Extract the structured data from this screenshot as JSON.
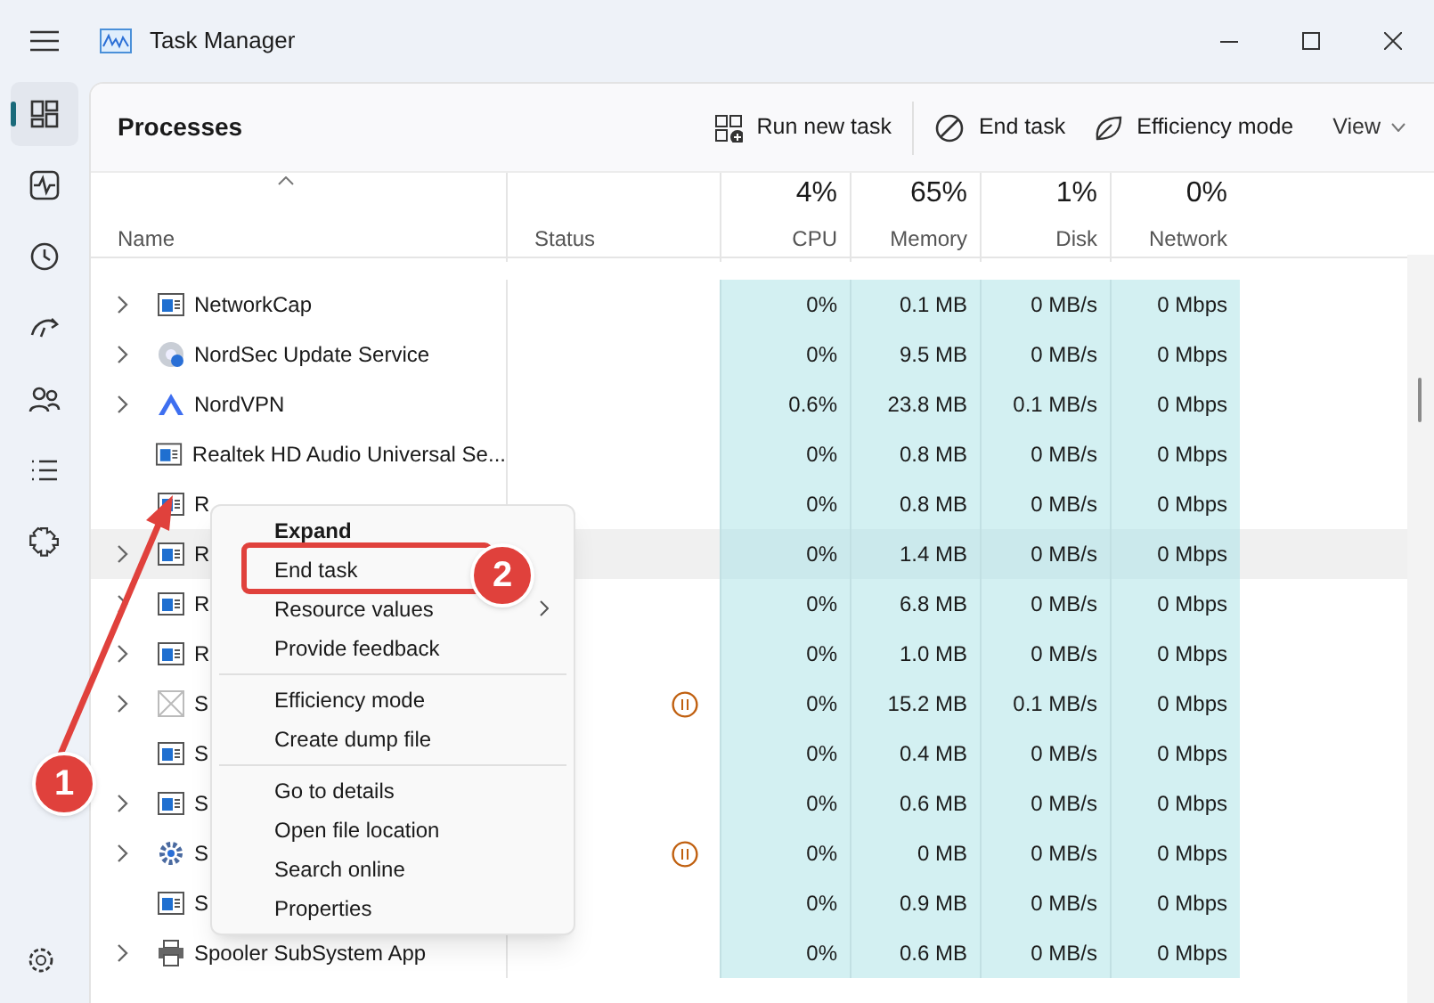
{
  "window": {
    "title": "Task Manager"
  },
  "nav": {
    "items": [
      {
        "kind": "processes",
        "selected": true
      },
      {
        "kind": "performance",
        "selected": false
      },
      {
        "kind": "history",
        "selected": false
      },
      {
        "kind": "startup",
        "selected": false
      },
      {
        "kind": "users",
        "selected": false
      },
      {
        "kind": "details",
        "selected": false
      },
      {
        "kind": "services",
        "selected": false
      }
    ]
  },
  "toolbar": {
    "title": "Processes",
    "actions": [
      {
        "kind": "run",
        "label": "Run new task"
      },
      {
        "kind": "end",
        "label": "End task"
      },
      {
        "kind": "efficiency",
        "label": "Efficiency mode"
      }
    ],
    "view": "View"
  },
  "columns": [
    {
      "label": "Name",
      "sorted": true
    },
    {
      "label": "Status",
      "sorted": false
    },
    {
      "total": "4%",
      "label": "CPU",
      "sorted": false
    },
    {
      "total": "65%",
      "label": "Memory",
      "sorted": false
    },
    {
      "total": "1%",
      "label": "Disk",
      "sorted": false
    },
    {
      "total": "0%",
      "label": "Network",
      "sorted": false
    }
  ],
  "rows": [
    {
      "name": "NetworkCap",
      "kind": "app",
      "expandable": true,
      "paused": false,
      "selected": false,
      "cpu": "0%",
      "memory": "0.1 MB",
      "disk": "0 MB/s",
      "network": "0 Mbps"
    },
    {
      "name": "NordSec Update Service",
      "kind": "disc",
      "expandable": true,
      "paused": false,
      "selected": false,
      "cpu": "0%",
      "memory": "9.5 MB",
      "disk": "0 MB/s",
      "network": "0 Mbps"
    },
    {
      "name": "NordVPN",
      "kind": "mountain",
      "expandable": true,
      "paused": false,
      "selected": false,
      "cpu": "0.6%",
      "memory": "23.8 MB",
      "disk": "0.1 MB/s",
      "network": "0 Mbps"
    },
    {
      "name": "Realtek HD Audio Universal Se...",
      "kind": "app",
      "expandable": false,
      "paused": false,
      "selected": false,
      "cpu": "0%",
      "memory": "0.8 MB",
      "disk": "0 MB/s",
      "network": "0 Mbps"
    },
    {
      "name": "R",
      "kind": "app",
      "expandable": false,
      "paused": false,
      "selected": false,
      "cpu": "0%",
      "memory": "0.8 MB",
      "disk": "0 MB/s",
      "network": "0 Mbps"
    },
    {
      "name": "R",
      "kind": "app",
      "expandable": true,
      "paused": false,
      "selected": true,
      "cpu": "0%",
      "memory": "1.4 MB",
      "disk": "0 MB/s",
      "network": "0 Mbps"
    },
    {
      "name": "R",
      "kind": "app",
      "expandable": true,
      "paused": false,
      "selected": false,
      "cpu": "0%",
      "memory": "6.8 MB",
      "disk": "0 MB/s",
      "network": "0 Mbps"
    },
    {
      "name": "R",
      "kind": "app",
      "expandable": true,
      "paused": false,
      "selected": false,
      "cpu": "0%",
      "memory": "1.0 MB",
      "disk": "0 MB/s",
      "network": "0 Mbps"
    },
    {
      "name": "S",
      "kind": "blank",
      "expandable": true,
      "paused": true,
      "selected": false,
      "cpu": "0%",
      "memory": "15.2 MB",
      "disk": "0.1 MB/s",
      "network": "0 Mbps"
    },
    {
      "name": "S",
      "kind": "app",
      "expandable": false,
      "paused": false,
      "selected": false,
      "cpu": "0%",
      "memory": "0.4 MB",
      "disk": "0 MB/s",
      "network": "0 Mbps"
    },
    {
      "name": "S",
      "kind": "app",
      "expandable": true,
      "paused": false,
      "selected": false,
      "cpu": "0%",
      "memory": "0.6 MB",
      "disk": "0 MB/s",
      "network": "0 Mbps"
    },
    {
      "name": "S",
      "kind": "gear",
      "expandable": true,
      "paused": true,
      "selected": false,
      "cpu": "0%",
      "memory": "0 MB",
      "disk": "0 MB/s",
      "network": "0 Mbps"
    },
    {
      "name": "S",
      "kind": "app",
      "expandable": false,
      "paused": false,
      "selected": false,
      "cpu": "0%",
      "memory": "0.9 MB",
      "disk": "0 MB/s",
      "network": "0 Mbps"
    },
    {
      "name": "Spooler SubSystem App",
      "kind": "printer",
      "expandable": true,
      "paused": false,
      "selected": false,
      "cpu": "0%",
      "memory": "0.6 MB",
      "disk": "0 MB/s",
      "network": "0 Mbps"
    }
  ],
  "context_menu": {
    "items": [
      {
        "label": "Expand",
        "default": true,
        "submenu": false,
        "separator_before": false
      },
      {
        "label": "End task",
        "default": false,
        "submenu": false,
        "separator_before": false
      },
      {
        "label": "Resource values",
        "default": false,
        "submenu": true,
        "separator_before": false
      },
      {
        "label": "Provide feedback",
        "default": false,
        "submenu": false,
        "separator_before": false
      },
      {
        "label": "Efficiency mode",
        "default": false,
        "submenu": false,
        "separator_before": true
      },
      {
        "label": "Create dump file",
        "default": false,
        "submenu": false,
        "separator_before": false
      },
      {
        "label": "Go to details",
        "default": false,
        "submenu": false,
        "separator_before": true
      },
      {
        "label": "Open file location",
        "default": false,
        "submenu": false,
        "separator_before": false
      },
      {
        "label": "Search online",
        "default": false,
        "submenu": false,
        "separator_before": false
      },
      {
        "label": "Properties",
        "default": false,
        "submenu": false,
        "separator_before": false
      }
    ]
  },
  "annotations": [
    {
      "label": "1"
    },
    {
      "label": "2"
    }
  ]
}
